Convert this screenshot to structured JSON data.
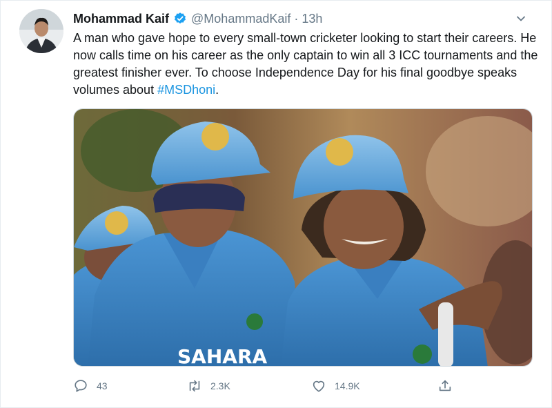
{
  "tweet": {
    "display_name": "Mohammad Kaif",
    "handle": "@MohammadKaif",
    "separator": "·",
    "time": "13h",
    "text_main": "A man who gave hope to every small-town cricketer looking to start their careers. He now calls time on his career as the only captain to win all 3 ICC tournaments and the greatest finisher ever. To choose Independence Day for his final goodbye speaks volumes about ",
    "hashtag": "#MSDhoni",
    "text_end": ".",
    "jersey_text": "SAHARA"
  },
  "actions": {
    "replies": "43",
    "retweets": "2.3K",
    "likes": "14.9K"
  },
  "colors": {
    "accent": "#1b95e0",
    "verified": "#1da1f2",
    "muted": "#657786",
    "jersey_blue": "#3a86c8"
  },
  "icons": [
    "verified-icon",
    "caret-down-icon",
    "reply-icon",
    "retweet-icon",
    "like-icon",
    "share-icon"
  ]
}
